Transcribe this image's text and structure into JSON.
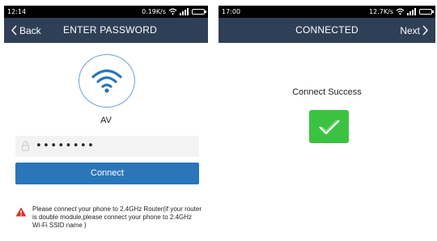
{
  "left_screen": {
    "status": {
      "time": "12:14",
      "speed": "0.19K/s"
    },
    "nav": {
      "back_label": "Back",
      "title": "ENTER PASSWORD"
    },
    "network_name": "AV",
    "password_value": "••••••••",
    "connect_label": "Connect",
    "warning_text": "Please connect your phone to 2.4GHz Router(if your router is double module,please connect your phone to 2.4GHz Wi-Fi SSID name )"
  },
  "right_screen": {
    "status": {
      "time": "17:00",
      "speed": "12.7K/s"
    },
    "nav": {
      "title": "CONNECTED",
      "next_label": "Next"
    },
    "success_text": "Connect Success"
  },
  "colors": {
    "navbar": "#2f3f56",
    "button": "#2b75b9",
    "success": "#3cc241",
    "wifi_icon": "#2b75b9",
    "warning": "#d9302b"
  },
  "icons": {
    "wifi": "wifi-icon",
    "lock": "lock-icon",
    "warning": "warning-triangle-icon",
    "check": "check-icon",
    "back": "chevron-left-icon",
    "next": "chevron-right-icon"
  }
}
